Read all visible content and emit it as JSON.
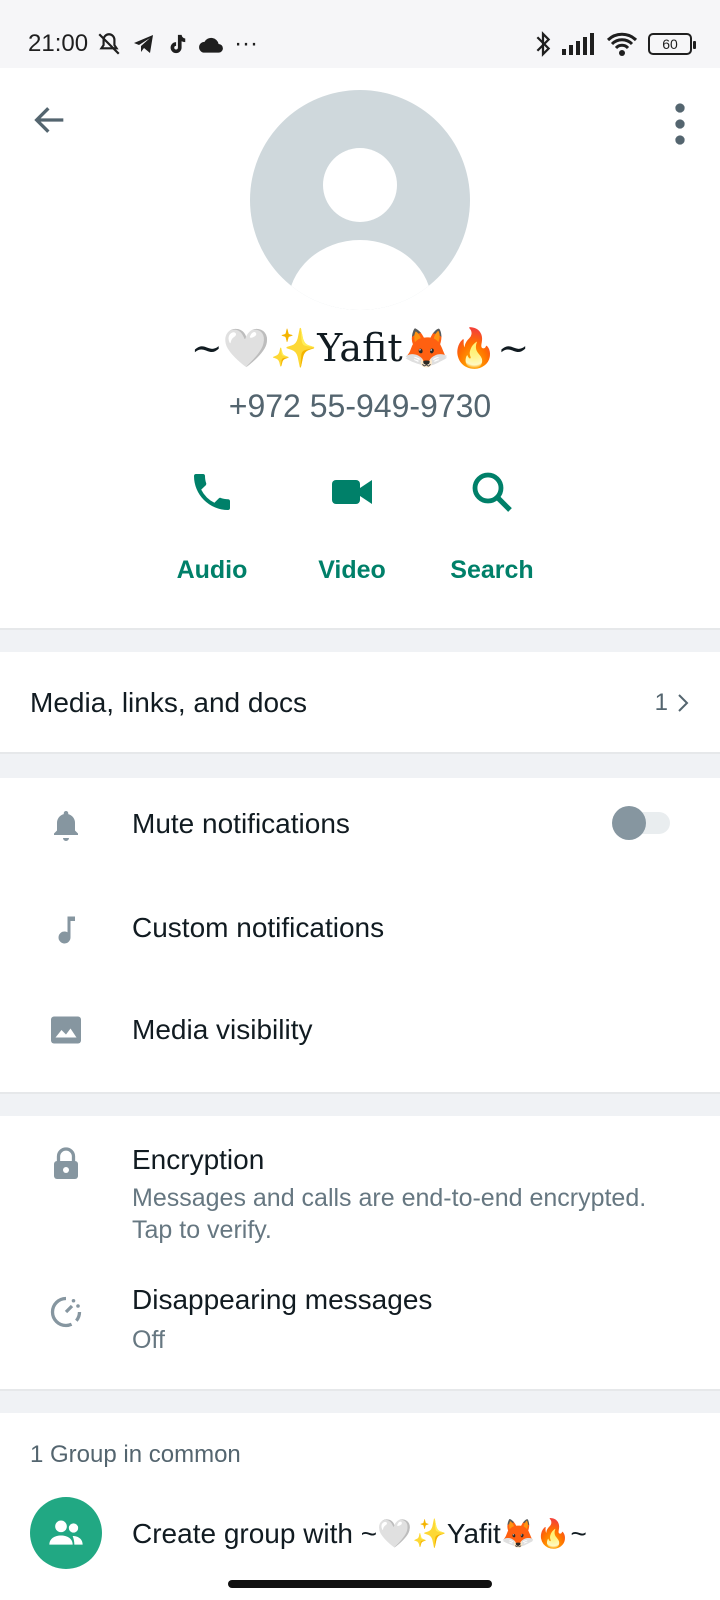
{
  "status_bar": {
    "time": "21:00",
    "more": "···",
    "battery": "60"
  },
  "contact": {
    "name": "~🤍✨Yafit🦊🔥~",
    "phone": "+972 55-949-9730"
  },
  "actions": [
    {
      "label": "Audio",
      "icon": "phone-icon"
    },
    {
      "label": "Video",
      "icon": "video-icon"
    },
    {
      "label": "Search",
      "icon": "search-icon"
    }
  ],
  "media": {
    "title": "Media, links, and docs",
    "count": "1"
  },
  "settings": {
    "mute": "Mute notifications",
    "mute_enabled": false,
    "custom": "Custom notifications",
    "visibility": "Media visibility"
  },
  "security": {
    "encryption_title": "Encryption",
    "encryption_sub": "Messages and calls are end-to-end encrypted. Tap to verify.",
    "disappearing_title": "Disappearing messages",
    "disappearing_value": "Off"
  },
  "groups": {
    "title": "1 Group in common",
    "create": "Create group with ~🤍✨Yafit🦊🔥~"
  },
  "colors": {
    "accent": "#008069",
    "icon_gray": "#8696a0",
    "secondary_text": "#54656f",
    "group_avatar": "#21a883"
  }
}
